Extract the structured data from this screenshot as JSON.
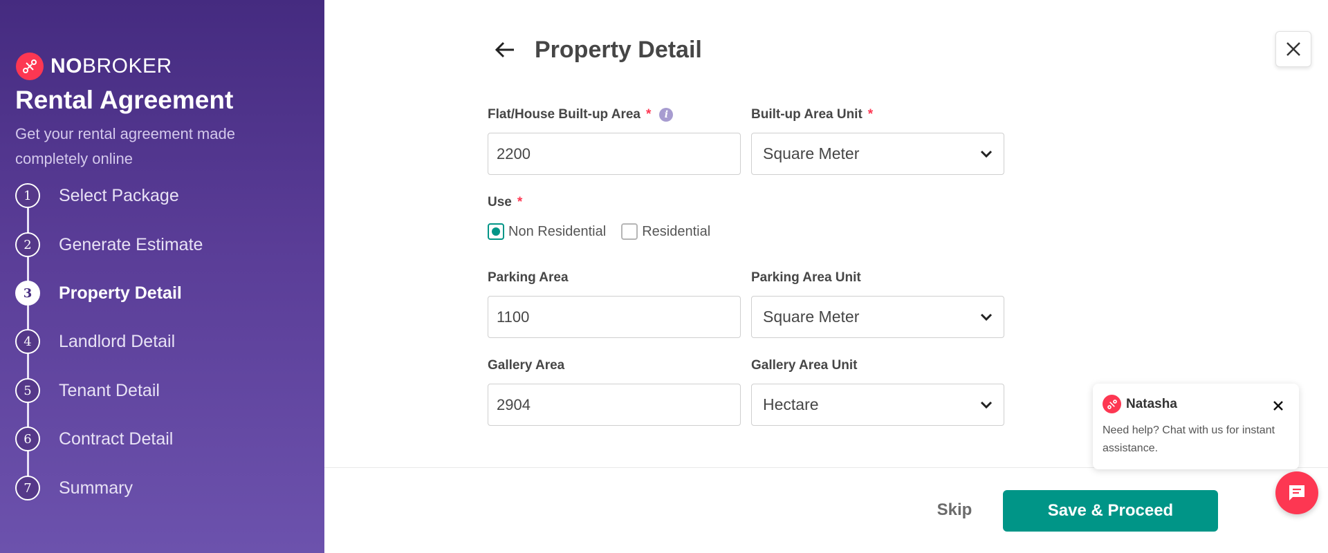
{
  "brand": {
    "name_bold": "NO",
    "name_light": "BROKER"
  },
  "sidebar": {
    "title": "Rental Agreement",
    "subtitle": "Get your rental agreement made completely online",
    "steps": [
      {
        "num": "1",
        "label": "Select Package"
      },
      {
        "num": "2",
        "label": "Generate Estimate"
      },
      {
        "num": "3",
        "label": "Property Detail"
      },
      {
        "num": "4",
        "label": "Landlord Detail"
      },
      {
        "num": "5",
        "label": "Tenant Detail"
      },
      {
        "num": "6",
        "label": "Contract Detail"
      },
      {
        "num": "7",
        "label": "Summary"
      }
    ],
    "active_step": "3"
  },
  "header": {
    "title": "Property Detail"
  },
  "form": {
    "builtup_area": {
      "label": "Flat/House Built-up Area",
      "required": "*",
      "value": "2200"
    },
    "builtup_unit": {
      "label": "Built-up Area Unit",
      "required": "*",
      "value": "Square Meter"
    },
    "use": {
      "label": "Use",
      "required": "*",
      "options": [
        {
          "label": "Non Residential",
          "checked": true
        },
        {
          "label": "Residential",
          "checked": false
        }
      ]
    },
    "parking_area": {
      "label": "Parking Area",
      "value": "1100"
    },
    "parking_unit": {
      "label": "Parking Area Unit",
      "value": "Square Meter"
    },
    "gallery_area": {
      "label": "Gallery Area",
      "value": "2904"
    },
    "gallery_unit": {
      "label": "Gallery Area Unit",
      "value": "Hectare"
    }
  },
  "footer": {
    "skip_label": "Skip",
    "save_label": "Save & Proceed"
  },
  "chat": {
    "agent_name": "Natasha",
    "message": "Need help? Chat with us for instant assistance."
  },
  "colors": {
    "sidebar_top": "#452b80",
    "sidebar_bottom": "#6c52ad",
    "accent_green": "#009587",
    "brand_red": "#fd3752"
  },
  "icons": {
    "back": "arrow-left-icon",
    "close": "close-icon",
    "info": "info-icon",
    "dropdown": "chevron-down-icon",
    "chat": "chat-bubble-icon"
  }
}
